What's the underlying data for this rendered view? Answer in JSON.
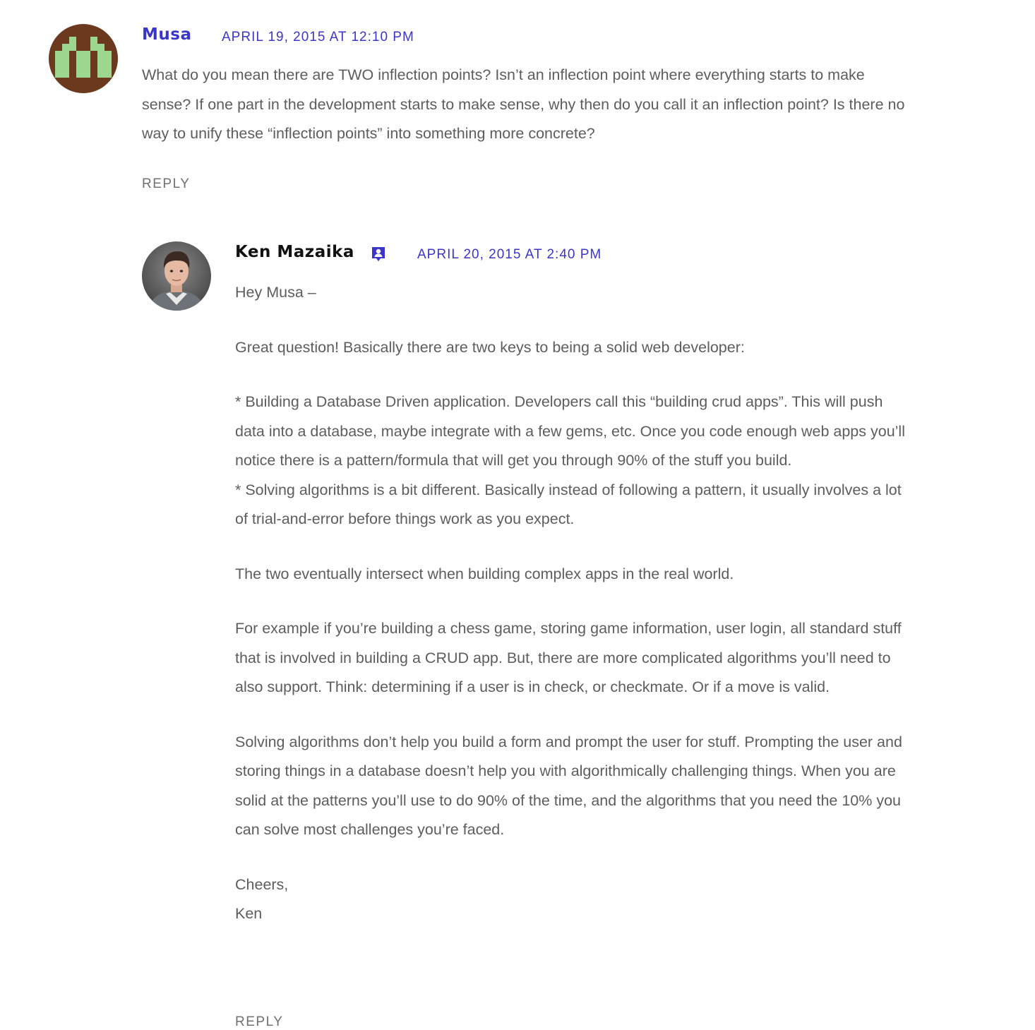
{
  "comments": [
    {
      "author": "Musa",
      "date": "APRIL 19, 2015 AT 12:10 PM",
      "avatar_icon": "identicon-avatar",
      "paragraphs": [
        "What do you mean there are TWO inflection points? Isn’t an inflection point where everything starts to make sense? If one part in the development starts to make sense, why then do you call it an inflection point? Is there no way to unify these “inflection points” into something more concrete?"
      ],
      "reply_label": "REPLY"
    },
    {
      "author": "Ken Mazaika",
      "date": "APRIL 20, 2015 AT 2:40 PM",
      "avatar_icon": "author-photo",
      "badge_icon": "post-author-badge-icon",
      "paragraphs": [
        "Hey Musa –",
        "Great question! Basically there are two keys to being a solid web developer:",
        "* Building a Database Driven application. Developers call this “building crud apps”. This will push data into a database, maybe integrate with a few gems, etc. Once you code enough web apps you’ll notice there is a pattern/formula that will get you through 90% of the stuff you build.\n* Solving algorithms is a bit different. Basically instead of following a pattern, it usually involves a lot of trial-and-error before things work as you expect.",
        "The two eventually intersect when building complex apps in the real world.",
        "For example if you’re building a chess game, storing game information, user login, all standard stuff that is involved in building a CRUD app. But, there are more complicated algorithms you’ll need to also support. Think: determining if a user is in check, or checkmate. Or if a move is valid.",
        "Solving algorithms don’t help you build a form and prompt the user for stuff. Prompting the user and storing things in a database doesn’t help you with algorithmically challenging things. When you are solid at the patterns you’ll use to do 90% of the time, and the algorithms that you need the 10% you can solve most challenges you’re faced.",
        "Cheers,\nKen"
      ],
      "reply_label": "REPLY"
    }
  ],
  "colors": {
    "link_blue": "#3b36c9",
    "author_dark": "#111111",
    "body_text": "#5d5d5d",
    "identicon_bg": "#6b3a1e",
    "identicon_fg": "#9dd68f"
  }
}
